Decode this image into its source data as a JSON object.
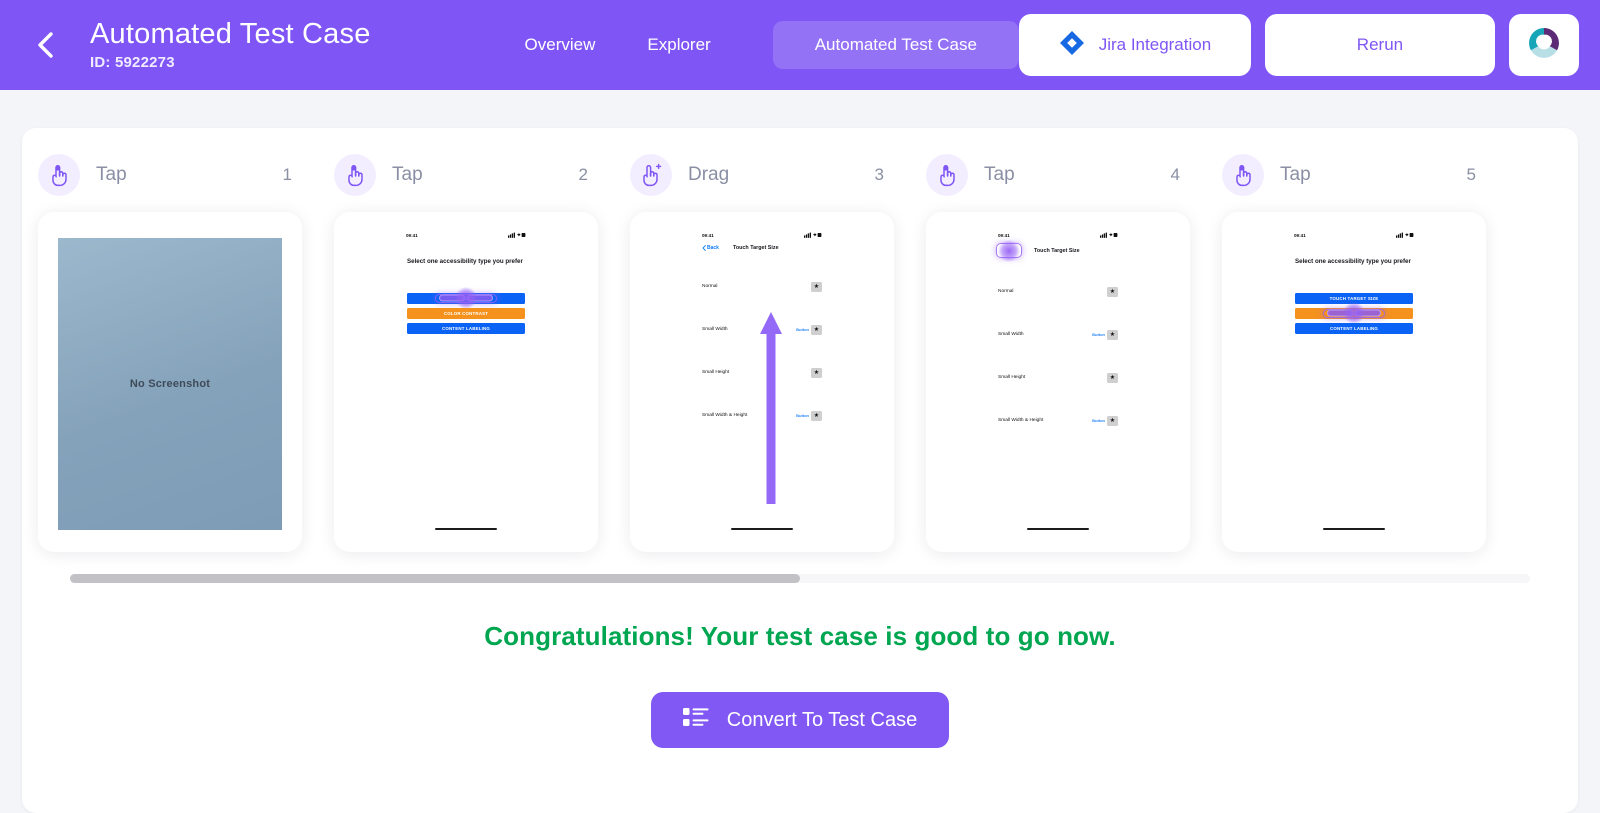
{
  "header": {
    "back_icon": "chevron-left-icon",
    "title": "Automated Test Case",
    "id_label": "ID: 5922273",
    "nav": [
      {
        "label": "Overview",
        "active": false
      },
      {
        "label": "Explorer",
        "active": false
      },
      {
        "label": "Automated Test Case",
        "active": true
      }
    ],
    "jira_button": "Jira Integration",
    "jira_icon": "jira-diamond-icon",
    "rerun_button": "Rerun",
    "avatar_icon": "app-logo-icon",
    "bg_color": "#7f56f5",
    "accent_color": "#7f56f5"
  },
  "steps": [
    {
      "action": "Tap",
      "icon": "tap-hand-icon",
      "number": "1",
      "screen": "none",
      "placeholder": "No Screenshot"
    },
    {
      "action": "Tap",
      "icon": "tap-hand-icon",
      "number": "2",
      "screen": "accessibility-select",
      "time": "09:41",
      "title": "Select one accessibility type you prefer",
      "buttons": [
        {
          "label": "",
          "color": "#0b63f6",
          "tapped": true
        },
        {
          "label": "COLOR CONTRAST",
          "color": "#f5921e",
          "tapped": false
        },
        {
          "label": "CONTENT LABELING",
          "color": "#0b63f6",
          "tapped": false
        }
      ]
    },
    {
      "action": "Drag",
      "icon": "drag-hand-icon",
      "number": "3",
      "screen": "touch-target-size",
      "time": "09:41",
      "back_label": "Back",
      "nav_title": "Touch Target Size",
      "rows": [
        {
          "label": "Normal",
          "button_label": "",
          "star": "★"
        },
        {
          "label": "Small Width",
          "button_label": "Button",
          "star": "★"
        },
        {
          "label": "Small Height",
          "button_label": "",
          "star": "★"
        },
        {
          "label": "Small Width & Height",
          "button_label": "Button",
          "star": "★"
        }
      ]
    },
    {
      "action": "Tap",
      "icon": "tap-hand-icon",
      "number": "4",
      "screen": "touch-target-size",
      "time": "09:41",
      "back_label": "",
      "nav_title": "Touch Target Size",
      "rows": [
        {
          "label": "Normal",
          "button_label": "",
          "star": "★"
        },
        {
          "label": "Small Width",
          "button_label": "Button",
          "star": "★"
        },
        {
          "label": "Small Height",
          "button_label": "",
          "star": "★"
        },
        {
          "label": "Small Width & Height",
          "button_label": "Button",
          "star": "★"
        }
      ]
    },
    {
      "action": "Tap",
      "icon": "tap-hand-icon",
      "number": "5",
      "screen": "accessibility-select",
      "time": "09:41",
      "title": "Select one accessibility type you prefer",
      "buttons": [
        {
          "label": "TOUCH TARGET SIZE",
          "color": "#0b63f6",
          "tapped": false
        },
        {
          "label": "",
          "color": "#f5921e",
          "tapped": true
        },
        {
          "label": "CONTENT LABELING",
          "color": "#0b63f6",
          "tapped": false
        }
      ]
    }
  ],
  "scrollbar": {
    "position": "left"
  },
  "footer": {
    "message": "Congratulations! Your test case is good to go now.",
    "message_color": "#00a650",
    "convert_button": "Convert To Test Case",
    "convert_icon": "list-icon"
  }
}
